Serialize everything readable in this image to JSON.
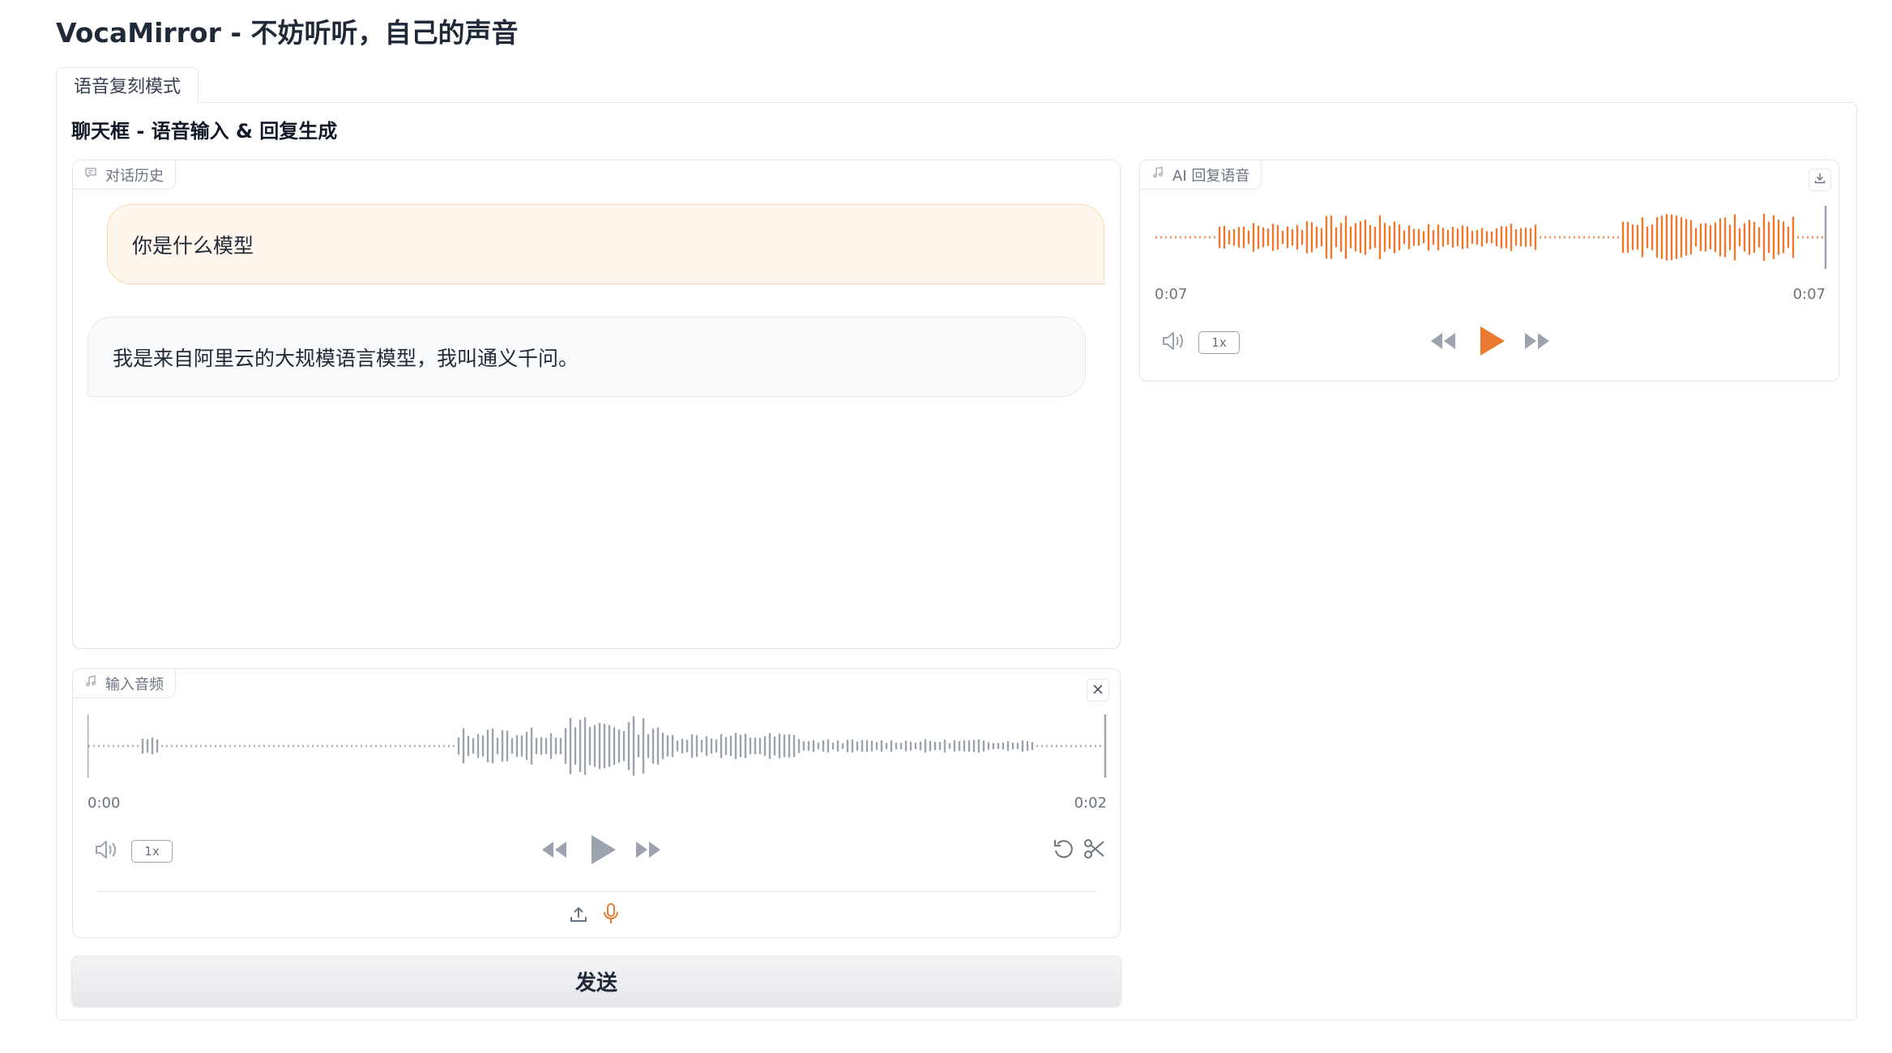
{
  "app": {
    "title": "VocaMirror - 不妨听听，自己的声音"
  },
  "tabs": [
    {
      "label": "语音复刻模式",
      "selected": true
    }
  ],
  "section": {
    "title": "聊天框 - 语音输入 & 回复生成"
  },
  "chat": {
    "label": "对话历史",
    "label_icon": "chat-icon",
    "messages": [
      {
        "role": "user",
        "text": "你是什么模型"
      },
      {
        "role": "assistant",
        "text": "我是来自阿里云的大规模语言模型，我叫通义千问。"
      }
    ]
  },
  "ai_audio": {
    "label": "AI 回复语音",
    "label_icon": "music-note-icon",
    "time_current": "0:07",
    "time_total": "0:07",
    "speed": "1x",
    "progress": 1.0,
    "waveform_color": "#ea7a2f"
  },
  "input_audio": {
    "label": "输入音频",
    "label_icon": "music-note-icon",
    "time_current": "0:00",
    "time_total": "0:02",
    "speed": "1x",
    "progress": 0.0,
    "waveform_color": "#9ca3af"
  },
  "send_button": {
    "label": "发送"
  },
  "colors": {
    "accent": "#ea7a2f",
    "muted": "#9ca3af"
  }
}
